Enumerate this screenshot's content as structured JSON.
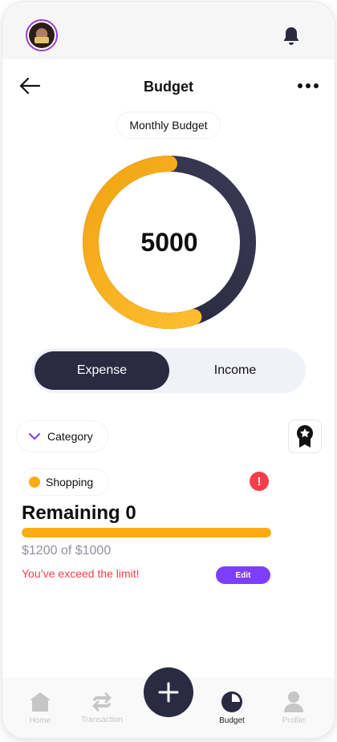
{
  "header": {
    "title": "Budget",
    "back_icon": "arrow-left-icon",
    "more_icon": "more-horizontal-icon"
  },
  "status_bar": {
    "avatar": "avatar",
    "bell_icon": "bell-icon"
  },
  "budget": {
    "period_label": "Monthly Budget",
    "total": "5000",
    "ring": {
      "expense_fraction": 0.55,
      "expense_color": "#fcac12",
      "remaining_color": "#2a2a42"
    }
  },
  "toggle": {
    "expense_label": "Expense",
    "income_label": "Income",
    "selected": "Expense"
  },
  "filter": {
    "category_label": "Category",
    "chevron_icon": "chevron-down-icon",
    "badge_icon": "award-ribbon-icon"
  },
  "budget_item": {
    "category": "Shopping",
    "category_color": "#fcac12",
    "alert_symbol": "!",
    "remaining": "Remaining 0",
    "progress_fraction": 1.0,
    "spent": "$1200 of $1000",
    "warning": "You’ve exceed the limit!",
    "edit_label": "Edit"
  },
  "nav": {
    "tabs": [
      {
        "label": "Home",
        "icon": "home-icon"
      },
      {
        "label": "Transaction",
        "icon": "transaction-icon"
      },
      {
        "label": "Budget",
        "icon": "pie-chart-icon"
      },
      {
        "label": "Profile",
        "icon": "user-icon"
      }
    ],
    "active": "Budget",
    "fab_icon": "plus-icon"
  },
  "colors": {
    "accent": "#7f3dff",
    "dark": "#2a2a42",
    "yellow": "#fcac12",
    "red": "#fd3c4a"
  }
}
